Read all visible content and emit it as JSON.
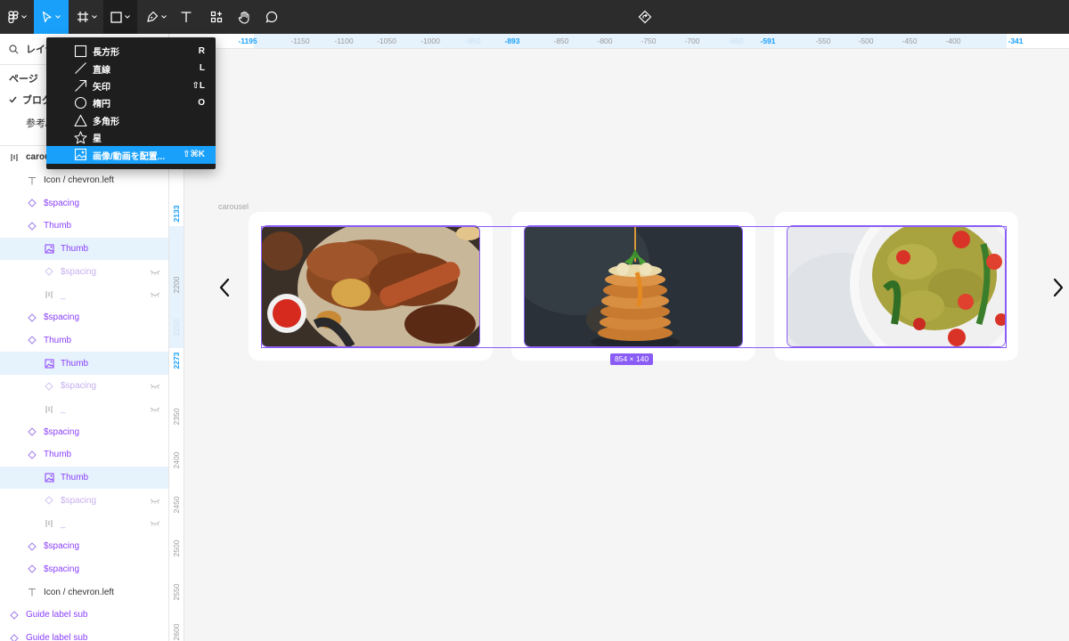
{
  "toolbar": {
    "tools": [
      "main-menu",
      "move",
      "frame",
      "shape",
      "pen",
      "text",
      "resources",
      "hand",
      "comment"
    ],
    "center_icon": "present-icon"
  },
  "sidebar": {
    "search_label": "レイヤ",
    "pages_title": "ページ",
    "pages": [
      {
        "label": "ブログ",
        "current": true
      },
      {
        "label": "参考/"
      }
    ],
    "layers": [
      {
        "label": "carou",
        "icon": "autolayout-icon",
        "indent": 0,
        "style": "bold"
      },
      {
        "label": "Icon / chevron.left",
        "icon": "text-icon",
        "indent": 1,
        "style": "normal"
      },
      {
        "label": "$spacing",
        "icon": "instance-icon",
        "indent": 1,
        "style": "comp"
      },
      {
        "label": "Thumb",
        "icon": "instance-icon",
        "indent": 1,
        "style": "comp"
      },
      {
        "label": "Thumb",
        "icon": "image-icon",
        "indent": 2,
        "style": "comp",
        "highlight": true
      },
      {
        "label": "$spacing",
        "icon": "instance-icon",
        "indent": 2,
        "style": "dim",
        "hidden": true
      },
      {
        "label": "_",
        "icon": "autolayout-icon",
        "indent": 2,
        "style": "dim",
        "hidden": true
      },
      {
        "label": "$spacing",
        "icon": "instance-icon",
        "indent": 1,
        "style": "comp"
      },
      {
        "label": "Thumb",
        "icon": "instance-icon",
        "indent": 1,
        "style": "comp"
      },
      {
        "label": "Thumb",
        "icon": "image-icon",
        "indent": 2,
        "style": "comp",
        "highlight": true
      },
      {
        "label": "$spacing",
        "icon": "instance-icon",
        "indent": 2,
        "style": "dim",
        "hidden": true
      },
      {
        "label": "_",
        "icon": "autolayout-icon",
        "indent": 2,
        "style": "dim",
        "hidden": true
      },
      {
        "label": "$spacing",
        "icon": "instance-icon",
        "indent": 1,
        "style": "comp"
      },
      {
        "label": "Thumb",
        "icon": "instance-icon",
        "indent": 1,
        "style": "comp"
      },
      {
        "label": "Thumb",
        "icon": "image-icon",
        "indent": 2,
        "style": "comp",
        "highlight": true
      },
      {
        "label": "$spacing",
        "icon": "instance-icon",
        "indent": 2,
        "style": "dim",
        "hidden": true
      },
      {
        "label": "_",
        "icon": "autolayout-icon",
        "indent": 2,
        "style": "dim",
        "hidden": true
      },
      {
        "label": "$spacing",
        "icon": "instance-icon",
        "indent": 1,
        "style": "comp"
      },
      {
        "label": "$spacing",
        "icon": "instance-icon",
        "indent": 1,
        "style": "comp"
      },
      {
        "label": "Icon / chevron.left",
        "icon": "text-icon",
        "indent": 1,
        "style": "normal"
      },
      {
        "label": "Guide label sub",
        "icon": "instance-icon",
        "indent": 0,
        "style": "comp"
      },
      {
        "label": "Guide label sub",
        "icon": "instance-icon",
        "indent": 0,
        "style": "comp"
      }
    ]
  },
  "ruler_top": [
    "-1195",
    "-1150",
    "-1100",
    "-1050",
    "-1000",
    "-950",
    "-893",
    "-850",
    "-800",
    "-750",
    "-700",
    "-650",
    "-591",
    "-550",
    "-500",
    "-450",
    "-400",
    "-341"
  ],
  "ruler_left": [
    "2133",
    "2200",
    "2250",
    "2273",
    "2350",
    "2400",
    "2450",
    "2500",
    "2550",
    "2600"
  ],
  "canvas": {
    "frame_label": "carousel",
    "size_badge": "854 × 140"
  },
  "menu": {
    "items": [
      {
        "label": "長方形",
        "shortcut": "R",
        "icon": "rectangle-icon"
      },
      {
        "label": "直線",
        "shortcut": "L",
        "icon": "line-icon"
      },
      {
        "label": "矢印",
        "shortcut": "⇧L",
        "icon": "arrow-icon"
      },
      {
        "label": "楕円",
        "shortcut": "O",
        "icon": "ellipse-icon"
      },
      {
        "label": "多角形",
        "shortcut": "",
        "icon": "polygon-icon"
      },
      {
        "label": "星",
        "shortcut": "",
        "icon": "star-icon"
      },
      {
        "label": "画像/動画を配置...",
        "shortcut": "⇧⌘K",
        "icon": "image-icon",
        "hover": true
      }
    ]
  },
  "colors": {
    "accent": "#18a0fb",
    "component": "#8a3ffc",
    "selection": "#8a5cf6",
    "toolbar_bg": "#2c2c2c"
  }
}
